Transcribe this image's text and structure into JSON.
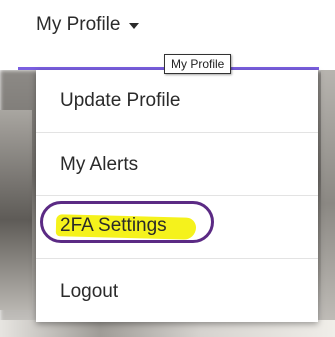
{
  "nav": {
    "trigger_label": "My Profile",
    "tooltip": "My Profile",
    "accent_color": "#7a5fe0"
  },
  "menu": {
    "items": [
      {
        "label": "Update Profile"
      },
      {
        "label": "My Alerts"
      },
      {
        "label": "2FA Settings",
        "annotated": true,
        "highlight_color": "#f5f21c",
        "ring_color": "#5b2a84"
      },
      {
        "label": "Logout"
      }
    ]
  }
}
